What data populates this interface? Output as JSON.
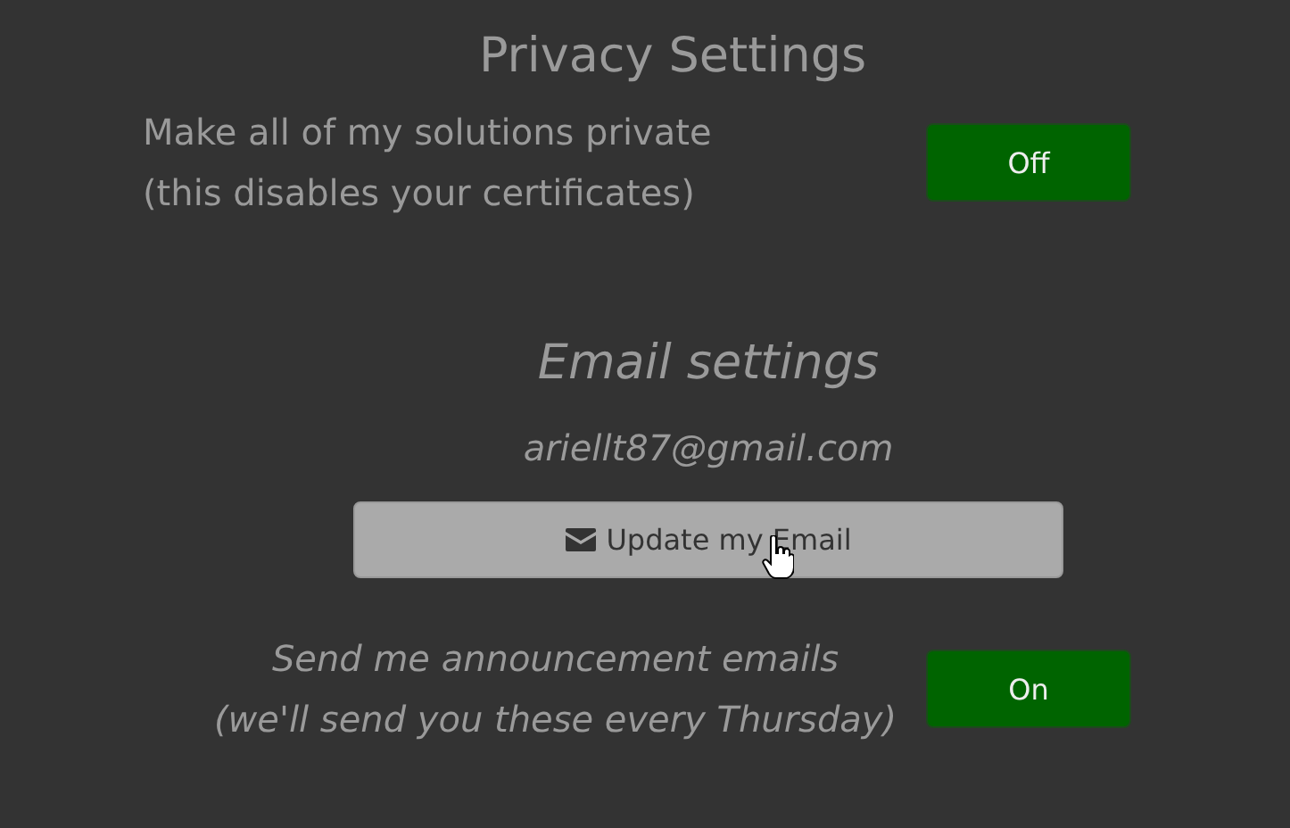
{
  "sections": [
    {
      "kind": "privacy",
      "title": "Privacy Settings",
      "toggles": [
        {
          "lines": [
            "Make all of my solutions private",
            "(this disables your certificates)"
          ],
          "button": "Off"
        }
      ]
    },
    {
      "kind": "email",
      "title": "Email settings",
      "email": "ariellt87@gmail.com",
      "update_button": "Update my Email",
      "toggles": [
        {
          "lines": [
            "Send me announcement emails",
            "(we'll send you these every Thursday)"
          ],
          "button": "On"
        }
      ]
    }
  ]
}
